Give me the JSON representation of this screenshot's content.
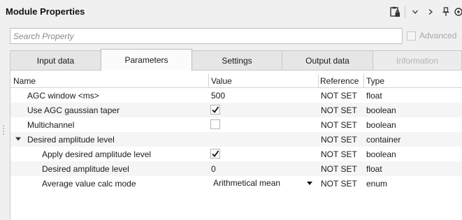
{
  "header": {
    "title": "Module Properties",
    "icons": [
      "clipboard-lock-icon",
      "chevron-down-icon",
      "chevron-right-icon",
      "pin-icon",
      "settings-icon"
    ]
  },
  "search": {
    "placeholder": "Search Property",
    "value": ""
  },
  "advanced": {
    "label": "Advanced",
    "checked": false,
    "enabled": false
  },
  "tabs": [
    {
      "label": "Input data",
      "active": false,
      "enabled": true
    },
    {
      "label": "Parameters",
      "active": true,
      "enabled": true
    },
    {
      "label": "Settings",
      "active": false,
      "enabled": true
    },
    {
      "label": "Output data",
      "active": false,
      "enabled": true
    },
    {
      "label": "Information",
      "active": false,
      "enabled": false
    }
  ],
  "table": {
    "columns": {
      "name": "Name",
      "value": "Value",
      "reference": "Reference",
      "type": "Type"
    },
    "rows": [
      {
        "name": "AGC window <ms>",
        "value": "500",
        "reference": "NOT SET",
        "type": "float"
      },
      {
        "name": "Use AGC gaussian taper",
        "checked": true,
        "reference": "NOT SET",
        "type": "boolean"
      },
      {
        "name": "Multichannel",
        "checked": false,
        "reference": "NOT SET",
        "type": "boolean"
      },
      {
        "name": "Desired amplitude level",
        "reference": "NOT SET",
        "type": "container",
        "expanded": true
      },
      {
        "name": "Apply desired amplitude level",
        "checked": true,
        "reference": "NOT SET",
        "type": "boolean"
      },
      {
        "name": "Desired amplitude level",
        "value": "0",
        "reference": "NOT SET",
        "type": "float"
      },
      {
        "name": "Average value calc mode",
        "value": "Arithmetical mean",
        "reference": "NOT SET",
        "type": "enum"
      }
    ]
  }
}
